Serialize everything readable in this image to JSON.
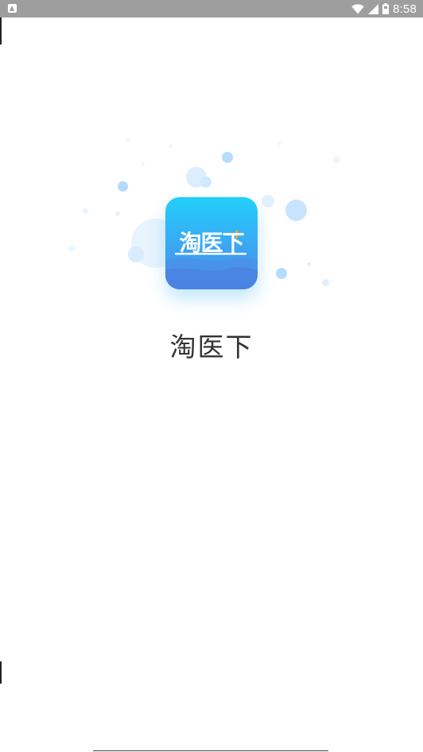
{
  "status_bar": {
    "time": "8:58",
    "notification_icon": "android-notification-icon",
    "wifi_icon": "wifi-icon",
    "signal_icon": "cell-signal-icon",
    "battery_icon": "battery-icon"
  },
  "splash": {
    "icon_text": "淘医下",
    "app_name": "淘医下",
    "colors": {
      "icon_top": "#21d0fb",
      "icon_bottom": "#4b8ae8",
      "bubble": "#d6ebfd",
      "accent": "#f5a623"
    }
  }
}
